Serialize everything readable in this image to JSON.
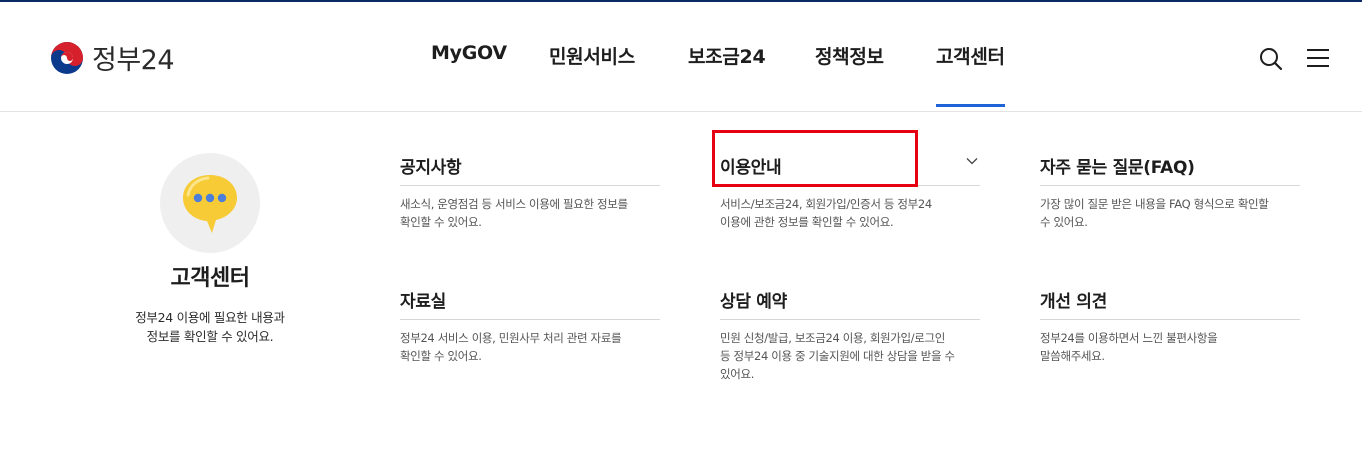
{
  "logo": {
    "text": "정부24"
  },
  "nav": {
    "items": [
      {
        "label": "MyGOV"
      },
      {
        "label": "민원서비스"
      },
      {
        "label": "보조금24"
      },
      {
        "label": "정책정보"
      },
      {
        "label": "고객센터",
        "active": true
      }
    ]
  },
  "utility": {
    "search_icon": "search-icon",
    "menu_icon": "hamburger-menu-icon"
  },
  "intro": {
    "title": "고객센터",
    "desc_line1": "정부24 이용에 필요한 내용과",
    "desc_line2": "정보를 확인할 수 있어요."
  },
  "cards": [
    {
      "title": "공지사항",
      "desc_line1": "새소식, 운영점검 등 서비스 이용에 필요한 정보를",
      "desc_line2": "확인할 수 있어요."
    },
    {
      "title": "이용안내",
      "desc_line1": "서비스/보조금24, 회원가입/인증서 등 정부24",
      "desc_line2": "이용에 관한 정보를 확인할 수 있어요.",
      "has_dropdown": true
    },
    {
      "title": "자주 묻는 질문(FAQ)",
      "desc_line1": "가장 많이 질문 받은 내용을 FAQ 형식으로 확인할",
      "desc_line2": "수 있어요."
    },
    {
      "title": "자료실",
      "desc_line1": "정부24 서비스 이용, 민원사무 처리 관련 자료를",
      "desc_line2": "확인할 수 있어요."
    },
    {
      "title": "상담 예약",
      "desc_line1": "민원 신청/발급, 보조금24 이용, 회원가입/로그인",
      "desc_line2": "등 정부24 이용 중 기술지원에 대한 상담을 받을 수",
      "desc_line3": "있어요."
    },
    {
      "title": "개선 의견",
      "desc_line1": "정부24를 이용하면서 느낀 불편사항을",
      "desc_line2": "말씀해주세요."
    }
  ],
  "colors": {
    "accent": "#1e64d6",
    "highlight": "#e60012",
    "topline": "#0b2a63"
  }
}
